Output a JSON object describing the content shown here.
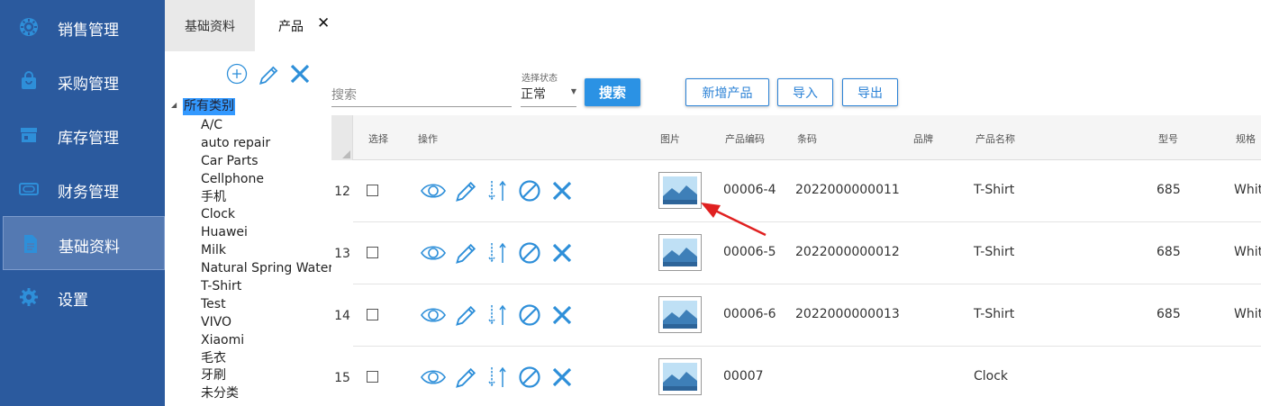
{
  "sidebar": {
    "items": [
      {
        "label": "销售管理",
        "icon": "gear-badge-icon"
      },
      {
        "label": "采购管理",
        "icon": "shopping-bag-icon"
      },
      {
        "label": "库存管理",
        "icon": "store-icon"
      },
      {
        "label": "财务管理",
        "icon": "money-icon"
      },
      {
        "label": "基础资料",
        "icon": "document-icon"
      },
      {
        "label": "设置",
        "icon": "gear-icon"
      }
    ],
    "active": "基础资料"
  },
  "tabs": [
    {
      "label": "基础资料"
    },
    {
      "label": "产品"
    }
  ],
  "tab_close": "✕",
  "tree": {
    "root": "所有类别",
    "items": [
      "A/C",
      "auto repair",
      "Car Parts",
      "Cellphone",
      "手机",
      "Clock",
      "Huawei",
      "Milk",
      "Natural Spring Water",
      "T-Shirt",
      "Test",
      "VIVO",
      "Xiaomi",
      "毛衣",
      "牙刷",
      "未分类"
    ]
  },
  "search": {
    "placeholder": "搜索",
    "status_label": "选择状态",
    "status_value": "正常",
    "search_button": "搜索",
    "add_button": "新增产品",
    "import_button": "导入",
    "export_button": "导出"
  },
  "table": {
    "headers": {
      "select": "选择",
      "actions": "操作",
      "image": "图片",
      "code": "产品编码",
      "barcode": "条码",
      "brand": "品牌",
      "name": "产品名称",
      "model": "型号",
      "spec": "规格"
    },
    "rows": [
      {
        "num": "12",
        "code": "00006-4",
        "barcode": "2022000000011",
        "brand": "",
        "name": "T-Shirt",
        "model": "685",
        "spec": "Whit"
      },
      {
        "num": "13",
        "code": "00006-5",
        "barcode": "2022000000012",
        "brand": "",
        "name": "T-Shirt",
        "model": "685",
        "spec": "Whit"
      },
      {
        "num": "14",
        "code": "00006-6",
        "barcode": "2022000000013",
        "brand": "",
        "name": "T-Shirt",
        "model": "685",
        "spec": "Whit"
      },
      {
        "num": "15",
        "code": "00007",
        "barcode": "",
        "brand": "",
        "name": "Clock",
        "model": "",
        "spec": ""
      }
    ]
  },
  "colors": {
    "sidebar_bg": "#2b5a9e",
    "accent": "#2b92e4",
    "icon_blue": "#2e8fd9",
    "annotation_red": "#e02020"
  }
}
